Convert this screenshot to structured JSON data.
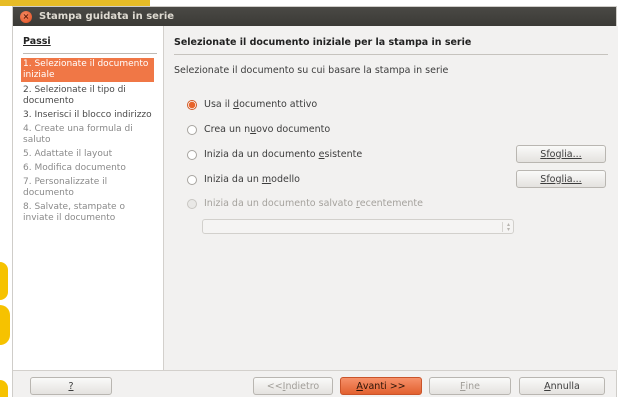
{
  "window": {
    "title": "Stampa guidata in serie"
  },
  "steps": {
    "heading": "Passi",
    "items": [
      {
        "label": "1. Selezionate il documento iniziale",
        "state": "active"
      },
      {
        "label": "2. Selezionate il tipo di documento",
        "state": "normal"
      },
      {
        "label": "3. Inserisci il blocco indirizzo",
        "state": "normal"
      },
      {
        "label": "4. Create una formula di saluto",
        "state": "muted"
      },
      {
        "label": "5. Adattate il layout",
        "state": "muted"
      },
      {
        "label": "6. Modifica documento",
        "state": "muted"
      },
      {
        "label": "7. Personalizzate il documento",
        "state": "muted"
      },
      {
        "label": "8. Salvate, stampate o inviate il documento",
        "state": "muted"
      }
    ]
  },
  "content": {
    "heading": "Selezionate il documento iniziale per la stampa in serie",
    "description": "Selezionate il documento su cui basare la stampa in serie",
    "options": {
      "current": {
        "pre": "Usa il ",
        "key": "d",
        "post": "ocumento attivo",
        "selected": true
      },
      "new": {
        "pre": "Crea un n",
        "key": "u",
        "post": "ovo documento",
        "selected": false
      },
      "existing": {
        "pre": "Inizia da un documento ",
        "key": "e",
        "post": "sistente",
        "selected": false
      },
      "template": {
        "pre": "Inizia da un ",
        "key": "m",
        "post": "odello",
        "selected": false
      },
      "recent": {
        "pre": "Inizia da un documento salvato ",
        "key": "r",
        "post": "ecentemente",
        "selected": false
      }
    },
    "browse": {
      "key": "S",
      "rest": "foglia..."
    }
  },
  "footer": {
    "help": "?",
    "back": {
      "pre": "<<",
      "key": "I",
      "post": "ndietro"
    },
    "next": {
      "key": "A",
      "post": "vanti >>"
    },
    "finish": {
      "key": "F",
      "post": "ine"
    },
    "cancel": {
      "key": "A",
      "post": "nnulla"
    }
  },
  "colors": {
    "accent": "#f07746",
    "titlebar": "#3b3a36",
    "background": "#f2f1f0"
  }
}
